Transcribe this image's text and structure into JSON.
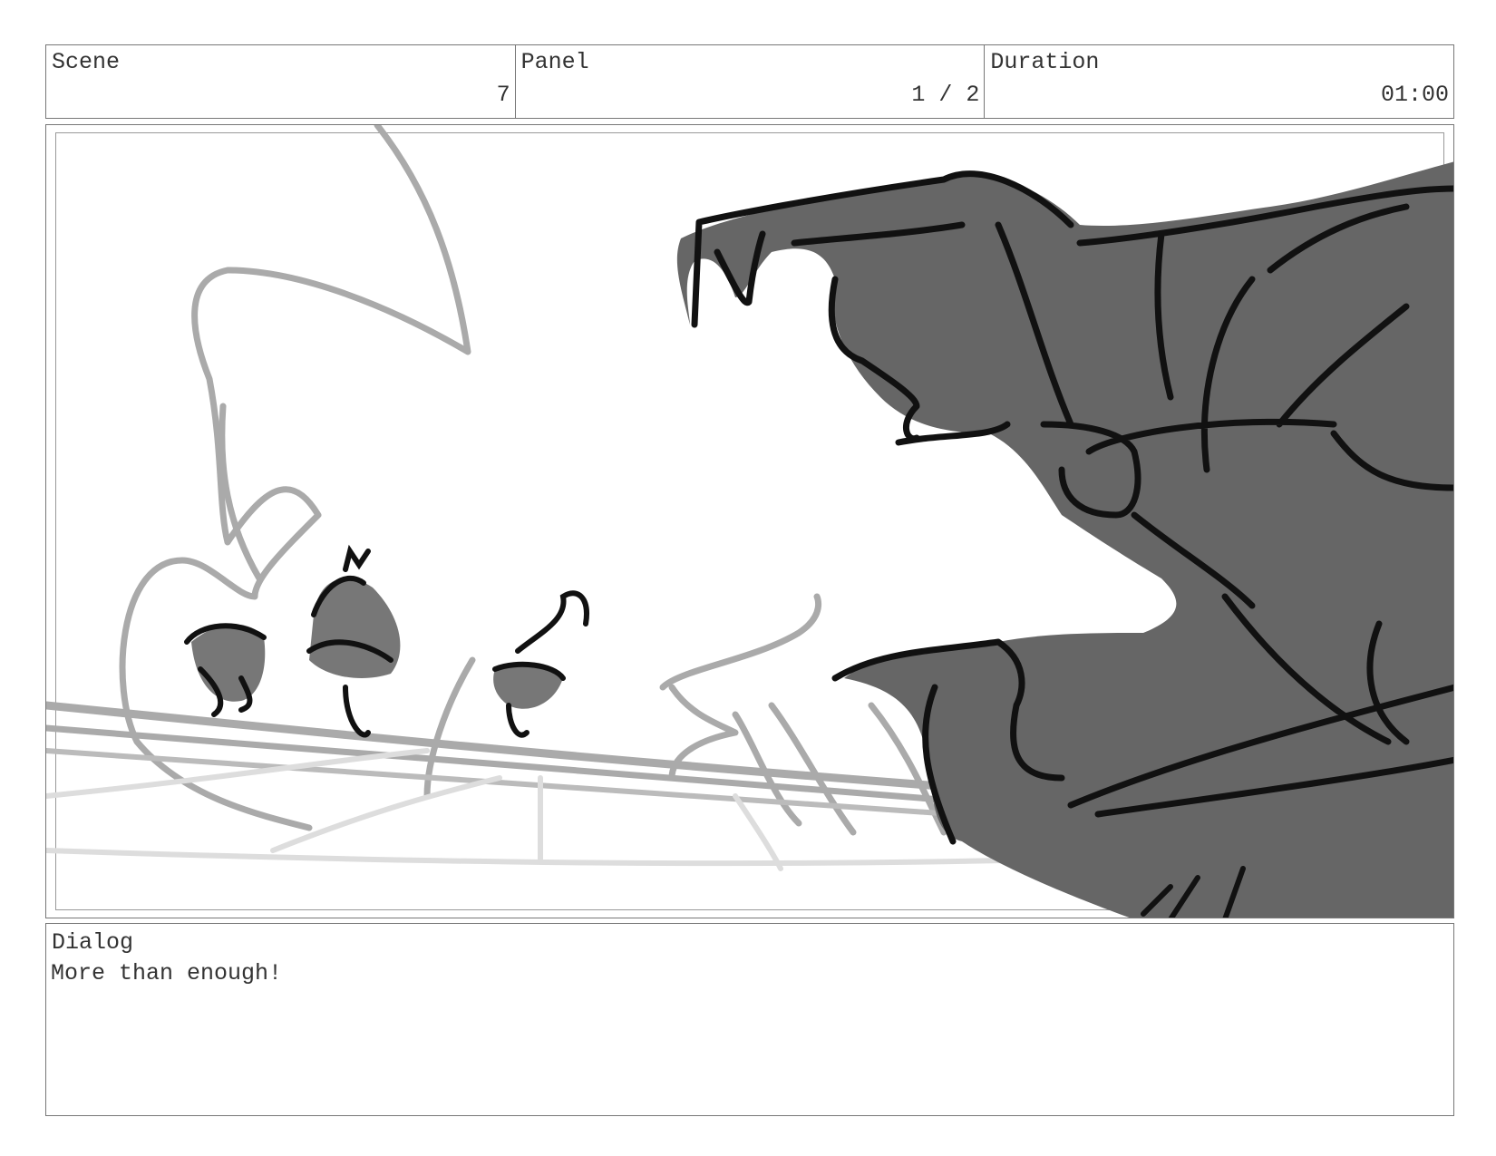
{
  "header": {
    "scene": {
      "label": "Scene",
      "value": "7"
    },
    "panel": {
      "label": "Panel",
      "value": "1 / 2"
    },
    "duration": {
      "label": "Duration",
      "value": "01:00"
    }
  },
  "artwork": {
    "description_icon": "storyboard-sketch",
    "colors": {
      "fill": "#666666",
      "line": "#111111",
      "background_line": "#aaaaaa",
      "light_line": "#dddddd"
    }
  },
  "dialog": {
    "label": "Dialog",
    "text": "More than enough!"
  }
}
